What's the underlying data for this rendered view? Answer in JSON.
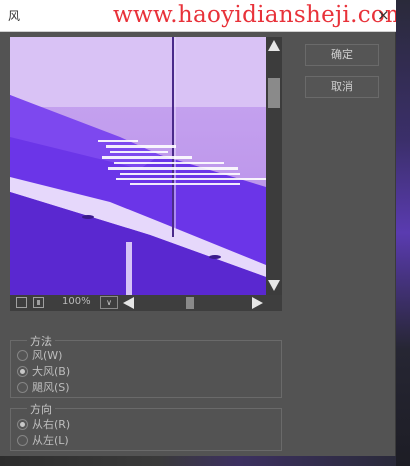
{
  "titlebar": {
    "title": "风",
    "watermark": "www.haoyidiansheji.com",
    "close_glyph": "×",
    "close_icon": "close-icon"
  },
  "buttons": {
    "ok_label": "确定",
    "cancel_label": "取消"
  },
  "preview_toolbar": {
    "zoom": "100%",
    "zoom_dropdown_glyph": "∨",
    "zoom_out_icon": "minus-box-icon",
    "zoom_in_icon": "plus-box-icon"
  },
  "method": {
    "legend": "方法",
    "options": [
      {
        "label": "风(W)",
        "selected": false
      },
      {
        "label": "大风(B)",
        "selected": true
      },
      {
        "label": "飓风(S)",
        "selected": false
      }
    ]
  },
  "direction": {
    "legend": "方向",
    "options": [
      {
        "label": "从右(R)",
        "selected": true
      },
      {
        "label": "从左(L)",
        "selected": false
      }
    ]
  },
  "colors": {
    "dialog_bg": "#535353",
    "preview_purple": "#8a5ce6",
    "watermark_red": "#e8323a"
  }
}
